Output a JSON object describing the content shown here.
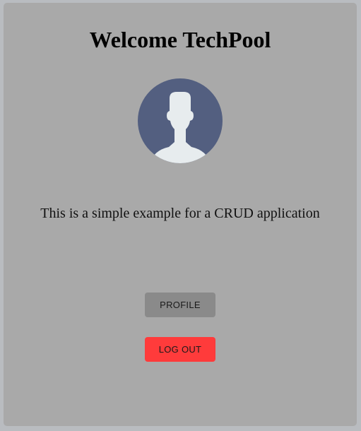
{
  "header": {
    "title": "Welcome TechPool"
  },
  "avatar": {
    "icon": "user-avatar-icon",
    "colors": {
      "background": "#535f80",
      "figure": "#e7ecee"
    }
  },
  "main": {
    "description": "This is a simple example for a CRUD application"
  },
  "actions": {
    "profile_label": "PROFILE",
    "logout_label": "LOG OUT"
  },
  "colors": {
    "page_background": "#b9bcc0",
    "card_background": "#a9a9a9",
    "profile_button": "#8a8a8a",
    "logout_button": "#ff3b3b"
  }
}
